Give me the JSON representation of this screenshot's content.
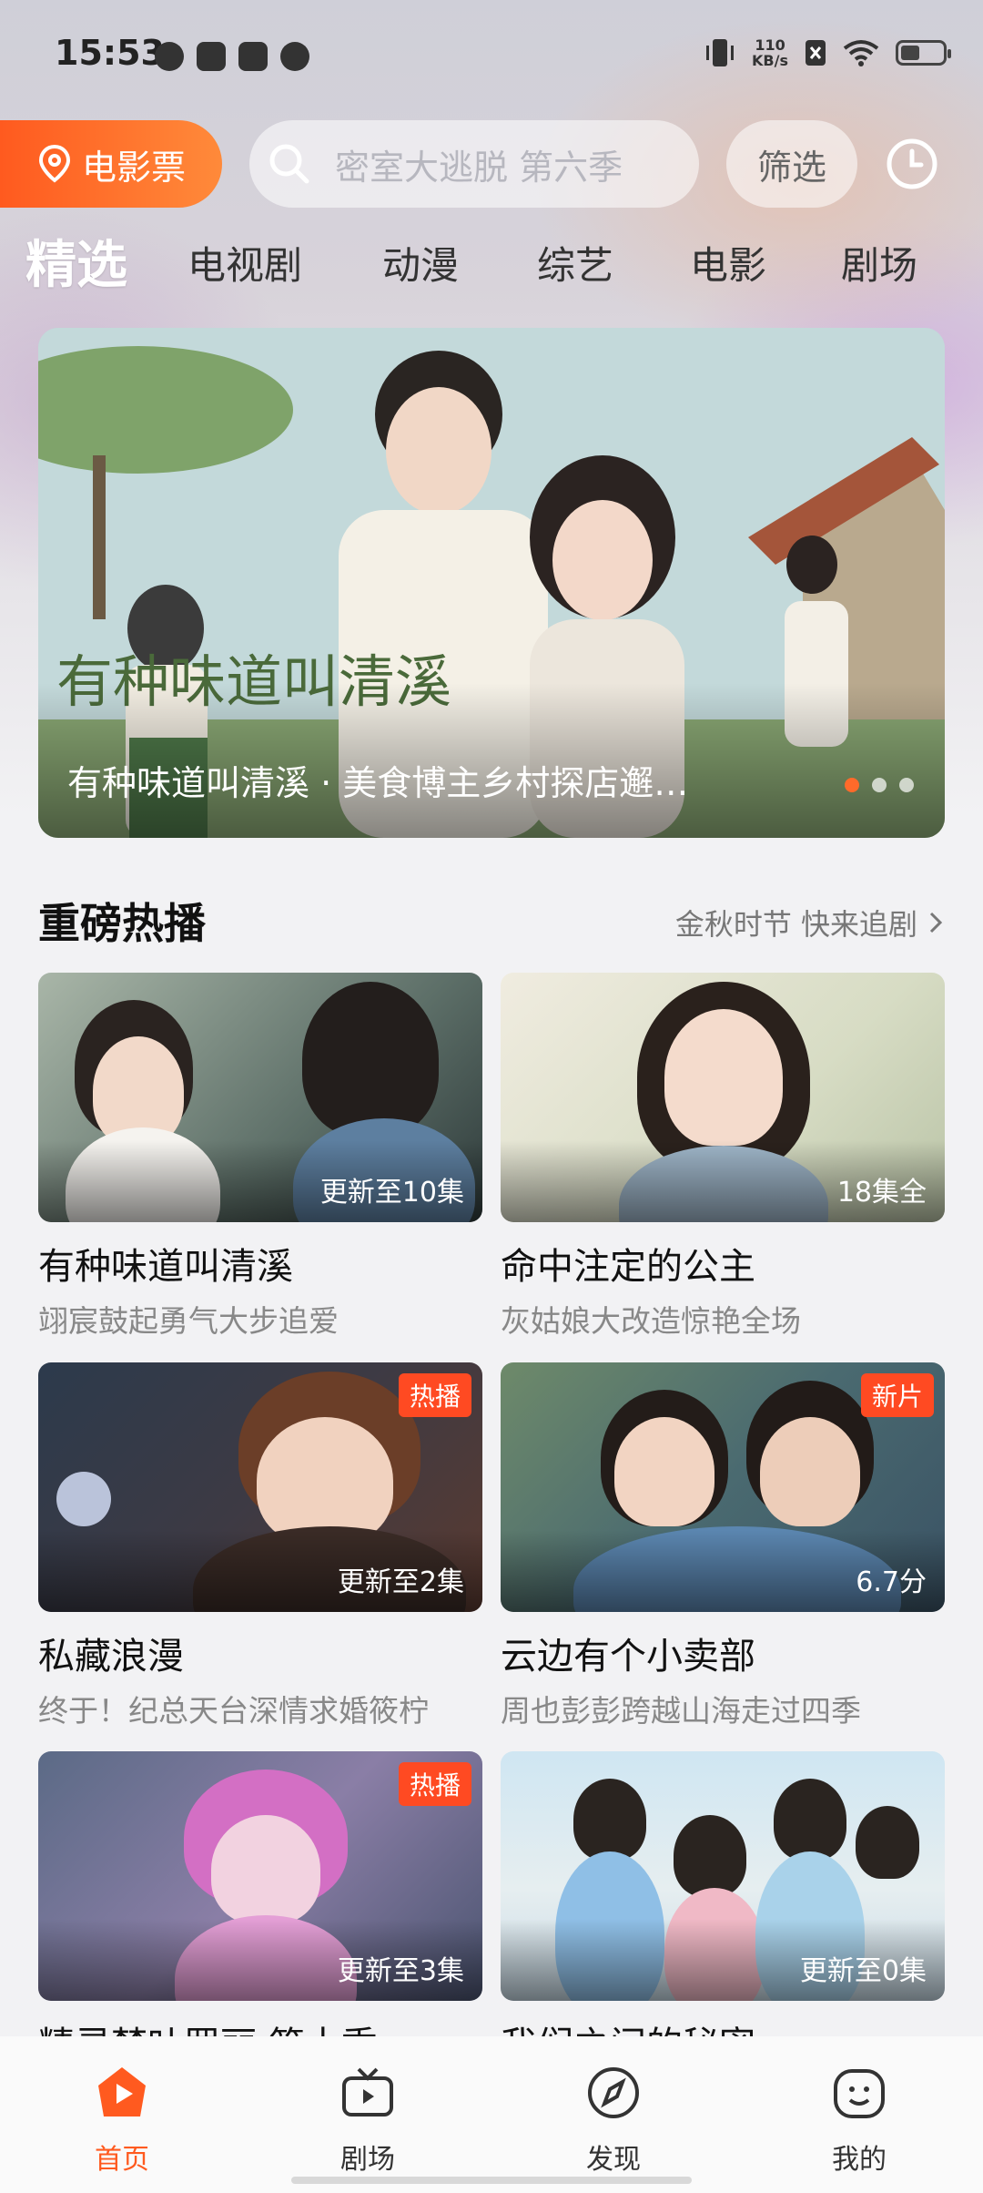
{
  "status_bar": {
    "time": "15:53",
    "net_speed_value": "110",
    "net_speed_unit": "KB/s",
    "battery_level": 0.45
  },
  "top_bar": {
    "ticket_label": "电影票",
    "search_placeholder": "密室大逃脱  第六季",
    "filter_label": "筛选"
  },
  "tabs": [
    {
      "label": "精选",
      "active": true
    },
    {
      "label": "电视剧"
    },
    {
      "label": "动漫"
    },
    {
      "label": "综艺"
    },
    {
      "label": "电影"
    },
    {
      "label": "剧场"
    }
  ],
  "banner": {
    "title": "有种味道叫清溪 · 美食博主乡村探店邂…",
    "art_text": "有种味道叫清溪",
    "dots": 3,
    "active_dot": 0
  },
  "section": {
    "title": "重磅热播",
    "more_label": "金秋时节 快来追剧"
  },
  "cards": [
    {
      "title": "有种味道叫清溪",
      "subtitle": "翊宸鼓起勇气大步追爱",
      "status": "更新至10集",
      "tag": ""
    },
    {
      "title": "命中注定的公主",
      "subtitle": "灰姑娘大改造惊艳全场",
      "status": "18集全",
      "tag": ""
    },
    {
      "title": "私藏浪漫",
      "subtitle": "终于！纪总天台深情求婚筱柠",
      "status": "更新至2集",
      "tag": "热播"
    },
    {
      "title": "云边有个小卖部",
      "subtitle": "周也彭彭跨越山海走过四季",
      "status": "6.7分",
      "tag": "新片"
    },
    {
      "title": "精灵梦叶罗丽 第十季",
      "subtitle": "",
      "status": "更新至3集",
      "tag": "热播"
    },
    {
      "title": "我们之间的秘密",
      "subtitle": "",
      "status": "更新至0集",
      "tag": ""
    }
  ],
  "bottom_nav": [
    {
      "label": "首页",
      "icon": "home-play-icon",
      "active": true
    },
    {
      "label": "剧场",
      "icon": "tv-icon"
    },
    {
      "label": "发现",
      "icon": "compass-icon"
    },
    {
      "label": "我的",
      "icon": "profile-face-icon"
    }
  ],
  "colors": {
    "accent": "#ff5a1f",
    "tag": "#ff4a22"
  }
}
